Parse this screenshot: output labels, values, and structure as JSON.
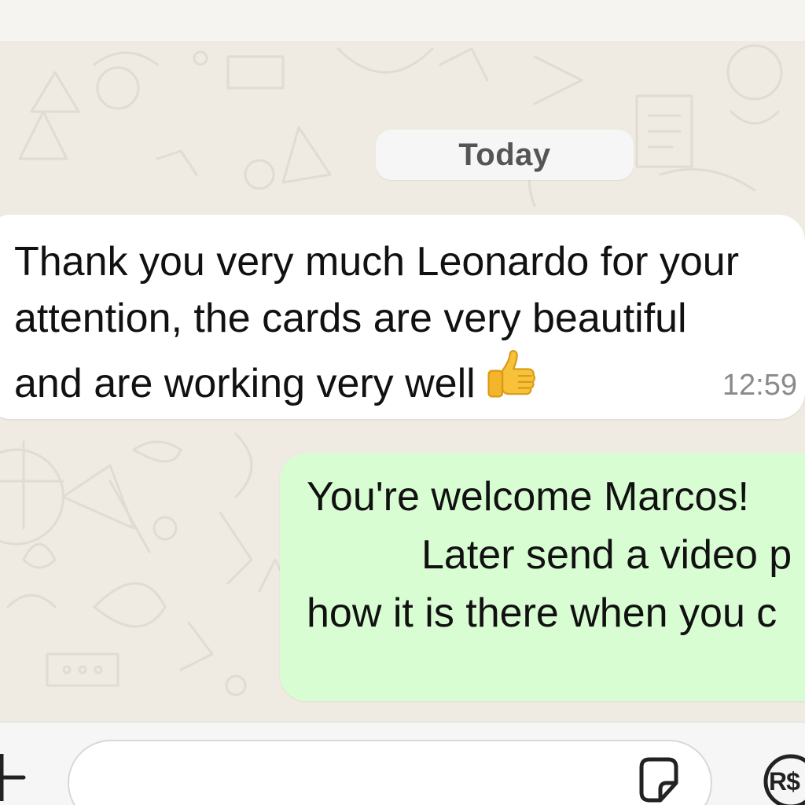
{
  "chat": {
    "date_label": "Today",
    "messages": [
      {
        "direction": "incoming",
        "text": "Thank you very much Leonardo for your\nattention, the cards are very beautiful\nand are working very well",
        "emoji": "thumbs-up",
        "time": "12:59"
      },
      {
        "direction": "outgoing",
        "lines": [
          "You're welcome Marcos!",
          "Later send a video p",
          "how it is there when you c"
        ]
      }
    ]
  },
  "composer": {
    "attach_icon": "plus-icon",
    "sticker_icon": "sticker-icon",
    "payment_icon": "payment-icon",
    "payment_label": "R$"
  },
  "colors": {
    "chat_background": "#efeae2",
    "incoming_bubble": "#ffffff",
    "outgoing_bubble": "#d9fdd3",
    "timestamp": "#8a8a8a"
  }
}
